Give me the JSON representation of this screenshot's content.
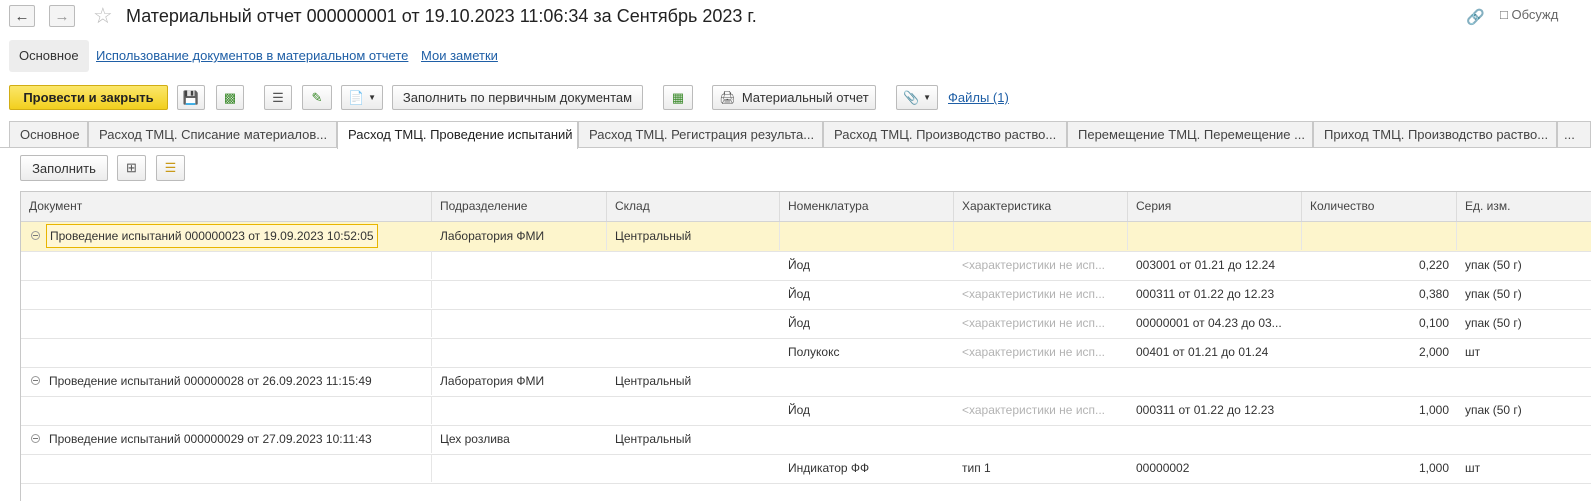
{
  "header": {
    "back_icon": "arrow-left-icon",
    "forward_icon": "arrow-right-icon",
    "title": "Материальный отчет 000000001 от 19.10.2023 11:06:34 за Сентябрь 2023 г.",
    "discuss_label": "Обсужд"
  },
  "subnav": {
    "main": "Основное",
    "usage": "Использование документов в материальном отчете",
    "notes": "Мои заметки"
  },
  "toolbar": {
    "post_close": "Провести и закрыть",
    "fill_primary": "Заполнить по первичным документам",
    "material_report": "Материальный отчет",
    "files": "Файлы (1)"
  },
  "tabs": [
    "Основное",
    "Расход ТМЦ. Списание материалов...",
    "Расход ТМЦ. Проведение испытаний",
    "Расход ТМЦ. Регистрация результа...",
    "Расход ТМЦ. Производство раство...",
    "Перемещение ТМЦ. Перемещение ...",
    "Приход ТМЦ. Производство раство..."
  ],
  "table_toolbar": {
    "fill": "Заполнить"
  },
  "table": {
    "columns": [
      "Документ",
      "Подразделение",
      "Склад",
      "Номенклатура",
      "Характеристика",
      "Серия",
      "Количество",
      "Ед. изм."
    ],
    "rows": [
      {
        "doc": "Проведение испытаний 000000023 от 19.09.2023 10:52:05",
        "dept": "Лаборатория ФМИ",
        "wh": "Центральный",
        "item": "",
        "char": "",
        "series": "",
        "qty": "",
        "unit": ""
      },
      {
        "doc": "",
        "dept": "",
        "wh": "",
        "item": "Йод",
        "char": "<характеристики не исп...",
        "series": "003001 от 01.21 до 12.24",
        "qty": "0,220",
        "unit": "упак (50 г)"
      },
      {
        "doc": "",
        "dept": "",
        "wh": "",
        "item": "Йод",
        "char": "<характеристики не исп...",
        "series": "000311 от 01.22 до 12.23",
        "qty": "0,380",
        "unit": "упак (50 г)"
      },
      {
        "doc": "",
        "dept": "",
        "wh": "",
        "item": "Йод",
        "char": "<характеристики не исп...",
        "series": "00000001 от 04.23 до 03...",
        "qty": "0,100",
        "unit": "упак (50 г)"
      },
      {
        "doc": "",
        "dept": "",
        "wh": "",
        "item": "Полукокс",
        "char": "<характеристики не исп...",
        "series": "00401 от 01.21 до 01.24",
        "qty": "2,000",
        "unit": "шт"
      },
      {
        "doc": "Проведение испытаний 000000028 от 26.09.2023 11:15:49",
        "dept": "Лаборатория ФМИ",
        "wh": "Центральный",
        "item": "",
        "char": "",
        "series": "",
        "qty": "",
        "unit": ""
      },
      {
        "doc": "",
        "dept": "",
        "wh": "",
        "item": "Йод",
        "char": "<характеристики не исп...",
        "series": "000311 от 01.22 до 12.23",
        "qty": "1,000",
        "unit": "упак (50 г)"
      },
      {
        "doc": "Проведение испытаний 000000029 от 27.09.2023 10:11:43",
        "dept": "Цех розлива",
        "wh": "Центральный",
        "item": "",
        "char": "",
        "series": "",
        "qty": "",
        "unit": ""
      },
      {
        "doc": "",
        "dept": "",
        "wh": "",
        "item": "Индикатор ФФ",
        "char": "тип 1",
        "series": "00000002",
        "qty": "1,000",
        "unit": "шт"
      }
    ]
  }
}
